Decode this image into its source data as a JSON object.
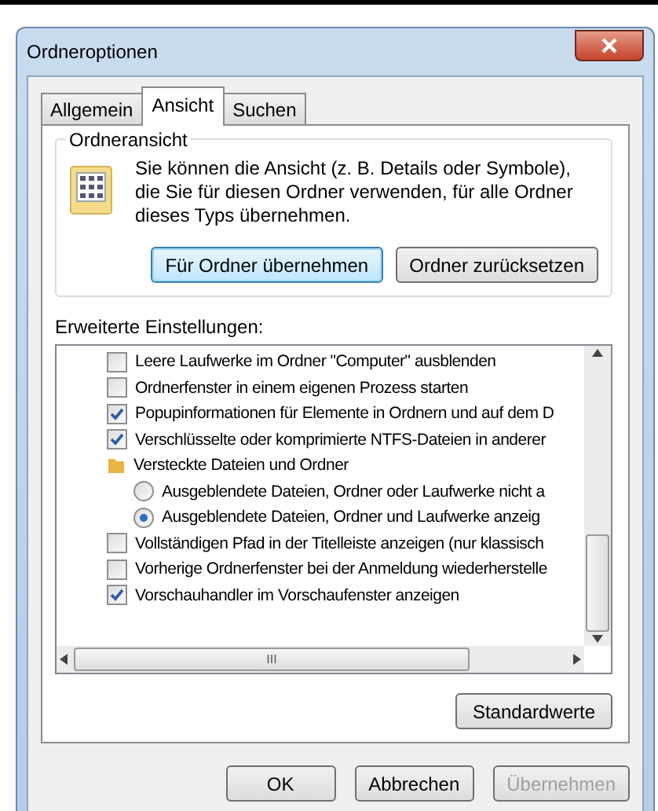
{
  "window": {
    "title": "Ordneroptionen"
  },
  "tabs": [
    {
      "label": "Allgemein",
      "selected": false
    },
    {
      "label": "Ansicht",
      "selected": true
    },
    {
      "label": "Suchen",
      "selected": false
    }
  ],
  "folder_view": {
    "title": "Ordneransicht",
    "description": "Sie können die Ansicht (z. B. Details oder Symbole), die Sie für diesen Ordner verwenden, für alle Ordner dieses Typs übernehmen.",
    "buttons": [
      {
        "label": "Für Ordner übernehmen",
        "focused": true
      },
      {
        "label": "Ordner zurücksetzen",
        "focused": false
      }
    ]
  },
  "advanced": {
    "label": "Erweiterte Einstellungen:",
    "items": [
      {
        "kind": "checkbox",
        "label": "Leere Laufwerke im Ordner \"Computer\" ausblenden",
        "checked": false
      },
      {
        "kind": "checkbox",
        "label": "Ordnerfenster in einem eigenen Prozess starten",
        "checked": false
      },
      {
        "kind": "checkbox",
        "label": "Popupinformationen für Elemente in Ordnern und auf dem D",
        "checked": true
      },
      {
        "kind": "checkbox",
        "label": "Verschlüsselte oder komprimierte NTFS-Dateien in anderer",
        "checked": true
      },
      {
        "kind": "folder",
        "label": "Versteckte Dateien und Ordner",
        "children": [
          {
            "kind": "radio",
            "label": "Ausgeblendete Dateien, Ordner oder Laufwerke nicht a",
            "selected": false
          },
          {
            "kind": "radio",
            "label": "Ausgeblendete Dateien, Ordner und Laufwerke anzeig",
            "selected": true
          }
        ]
      },
      {
        "kind": "checkbox",
        "label": "Vollständigen Pfad in der Titelleiste anzeigen (nur klassisch",
        "checked": false
      },
      {
        "kind": "checkbox",
        "label": "Vorherige Ordnerfenster bei der Anmeldung wiederherstelle",
        "checked": false
      },
      {
        "kind": "checkbox",
        "label": "Vorschauhandler im Vorschaufenster anzeigen",
        "checked": true
      }
    ],
    "scroll_label": "III"
  },
  "defaults_button": "Standardwerte",
  "buttons": [
    {
      "label": "OK",
      "disabled": false
    },
    {
      "label": "Abbrechen",
      "disabled": false
    },
    {
      "label": "Übernehmen",
      "disabled": true
    }
  ]
}
